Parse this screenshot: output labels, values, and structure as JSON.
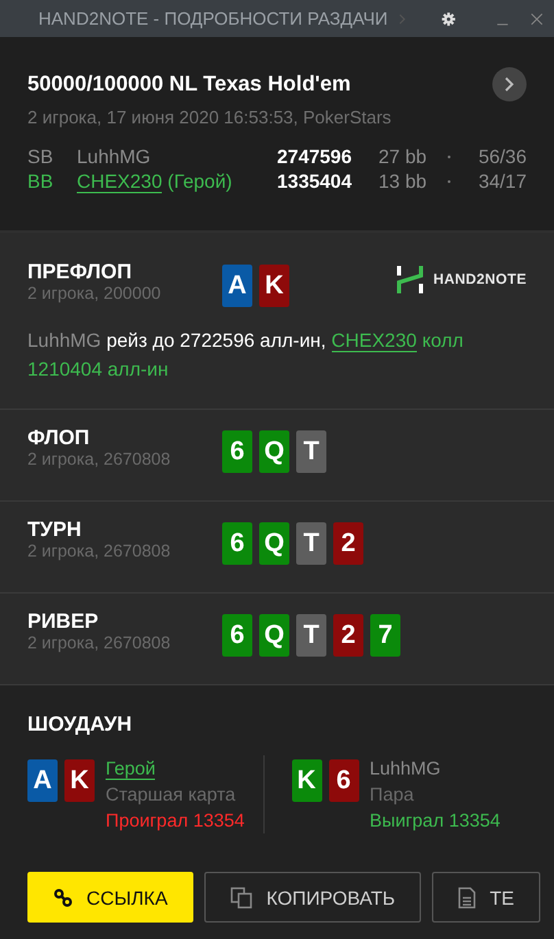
{
  "window": {
    "title": "HAND2NOTE - ПОДРОБНОСТИ РАЗДАЧИ"
  },
  "header": {
    "title": "50000/100000 NL Texas Hold'em",
    "subtitle": "2 игрока, 17 июня 2020 16:53:53, PokerStars"
  },
  "players": [
    {
      "position": "SB",
      "name": "LuhhMG",
      "hero": false,
      "stack": "2747596",
      "bb": "27 bb",
      "stats": "56/36"
    },
    {
      "position": "BB",
      "name": "CHEX230",
      "hero": true,
      "hero_label": "(Герой)",
      "stack": "1335404",
      "bb": "13 bb",
      "stats": "34/17"
    }
  ],
  "logo": {
    "text": "HAND2NOTE"
  },
  "streets": [
    {
      "name": "ПРЕФЛОП",
      "info": "2 игрока, 200000",
      "cards": [
        {
          "rank": "A",
          "color": "#0a5aa6"
        },
        {
          "rank": "K",
          "color": "#8e0a0a"
        }
      ],
      "actions": [
        {
          "kind": "player",
          "text": "LuhhMG"
        },
        {
          "kind": "text",
          "text": "рейз до 2722596 алл-ин,"
        },
        {
          "kind": "hero",
          "text": "CHEX230"
        },
        {
          "kind": "hero_text",
          "text": "колл 1210404 алл-ин"
        }
      ]
    },
    {
      "name": "ФЛОП",
      "info": "2 игрока, 2670808",
      "cards": [
        {
          "rank": "6",
          "color": "#0b8a0b"
        },
        {
          "rank": "Q",
          "color": "#0b8a0b"
        },
        {
          "rank": "T",
          "color": "#5e5e5e"
        }
      ]
    },
    {
      "name": "ТУРН",
      "info": "2 игрока, 2670808",
      "cards": [
        {
          "rank": "6",
          "color": "#0b8a0b"
        },
        {
          "rank": "Q",
          "color": "#0b8a0b"
        },
        {
          "rank": "T",
          "color": "#5e5e5e"
        },
        {
          "rank": "2",
          "color": "#8e0a0a"
        }
      ]
    },
    {
      "name": "РИВЕР",
      "info": "2 игрока, 2670808",
      "cards": [
        {
          "rank": "6",
          "color": "#0b8a0b"
        },
        {
          "rank": "Q",
          "color": "#0b8a0b"
        },
        {
          "rank": "T",
          "color": "#5e5e5e"
        },
        {
          "rank": "2",
          "color": "#8e0a0a"
        },
        {
          "rank": "7",
          "color": "#0b8a0b"
        }
      ]
    }
  ],
  "showdown": {
    "title": "ШОУДАУН",
    "hands": [
      {
        "name": "Герой",
        "hero": true,
        "combo": "Старшая карта",
        "result": "Проиграл 13354",
        "won": false,
        "cards": [
          {
            "rank": "A",
            "color": "#0a5aa6"
          },
          {
            "rank": "K",
            "color": "#8e0a0a"
          }
        ]
      },
      {
        "name": "LuhhMG",
        "hero": false,
        "combo": "Пара",
        "result": "Выиграл 13354",
        "won": true,
        "cards": [
          {
            "rank": "K",
            "color": "#0b8a0b"
          },
          {
            "rank": "6",
            "color": "#8e0a0a"
          }
        ]
      }
    ]
  },
  "buttons": [
    {
      "kind": "link",
      "label": "ССЫЛКА"
    },
    {
      "kind": "copy",
      "label": "КОПИРОВАТЬ"
    },
    {
      "kind": "text",
      "label": "ТЕ"
    }
  ]
}
